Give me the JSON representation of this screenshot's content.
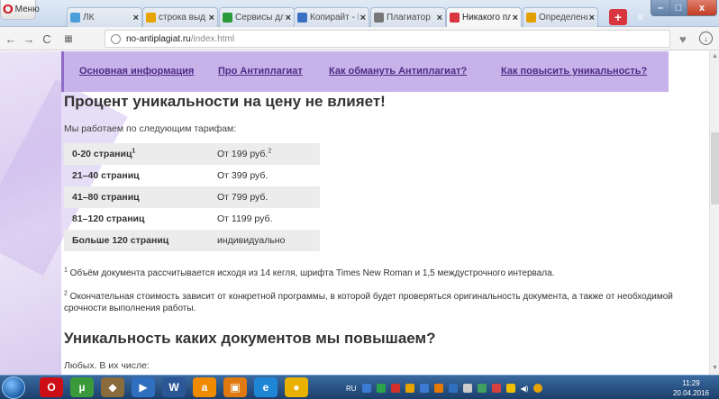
{
  "browser": {
    "menu_label": "Меню",
    "tabs": [
      {
        "label": "ЛК",
        "active": false,
        "color": "#4a9fd8"
      },
      {
        "label": "строка выд",
        "active": false,
        "color": "#e8a400"
      },
      {
        "label": "Сервисы дл",
        "active": false,
        "color": "#2a9a3a"
      },
      {
        "label": "Копирайт - I",
        "active": false,
        "color": "#3b6fc4"
      },
      {
        "label": "Плагиатор",
        "active": false,
        "color": "#777777"
      },
      {
        "label": "Никакого пл",
        "active": true,
        "color": "#d8353f"
      },
      {
        "label": "Определени",
        "active": false,
        "color": "#e2a000"
      }
    ],
    "url_host": "no-antiplagiat.ru",
    "url_path": "/index.html"
  },
  "site": {
    "nav": [
      "Основная информация",
      "Про Антиплагиат",
      "Как обмануть Антиплагиат?",
      "Как повысить уникальность?"
    ],
    "heading": "Процент уникальности на цену не влияет!",
    "intro": "Мы работаем по следующим тарифам:",
    "prices": [
      {
        "pages": "0-20 страниц",
        "pages_sup": "1",
        "price": "От 199 руб.",
        "price_sup": "2"
      },
      {
        "pages": "21–40 страниц",
        "pages_sup": "",
        "price": "От 399 руб.",
        "price_sup": ""
      },
      {
        "pages": "41–80 страниц",
        "pages_sup": "",
        "price": "От 799 руб.",
        "price_sup": ""
      },
      {
        "pages": "81–120 страниц",
        "pages_sup": "",
        "price": "От 1199 руб.",
        "price_sup": ""
      },
      {
        "pages": "Больше 120 страниц",
        "pages_sup": "",
        "price": "индивидуально",
        "price_sup": ""
      }
    ],
    "footnote1_mark": "1",
    "footnote1": " Объём документа рассчитывается исходя из 14 кегля, шрифта Times New Roman и 1,5 междустрочного интервала.",
    "footnote2_mark": "2",
    "footnote2": " Окончательная стоимость зависит от конкретной программы, в которой будет проверяться оригинальность документа, а также от необходимой срочности выполнения работы.",
    "heading2": "Уникальность каких документов мы повышаем?",
    "any_text": "Любых. В их числе:"
  },
  "taskbar": {
    "apps": [
      {
        "name": "opera",
        "color": "#cc0f16",
        "glyph": "O"
      },
      {
        "name": "torrent",
        "color": "#3a9a3a",
        "glyph": "µ"
      },
      {
        "name": "gimp",
        "color": "#8a6b3b",
        "glyph": "◆"
      },
      {
        "name": "media-player",
        "color": "#2f6fc0",
        "glyph": "▶"
      },
      {
        "name": "word",
        "color": "#2b5797",
        "glyph": "W"
      },
      {
        "name": "avast",
        "color": "#f08b00",
        "glyph": "a"
      },
      {
        "name": "files",
        "color": "#e07a10",
        "glyph": "▣"
      },
      {
        "name": "ie",
        "color": "#1f86d6",
        "glyph": "e"
      },
      {
        "name": "chrome",
        "color": "#e8b100",
        "glyph": "●"
      }
    ],
    "language": "RU",
    "time": "11:29",
    "date": "20.04.2016"
  }
}
